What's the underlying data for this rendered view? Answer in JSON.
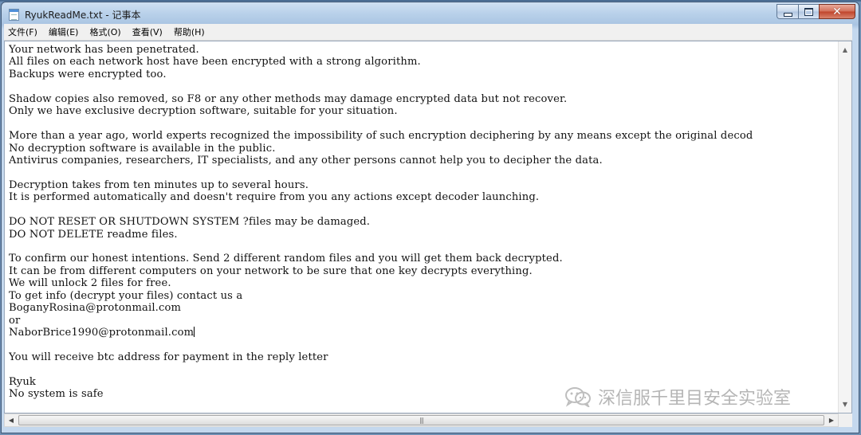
{
  "window": {
    "title": "RyukReadMe.txt - 记事本"
  },
  "menubar": {
    "items": [
      "文件(F)",
      "编辑(E)",
      "格式(O)",
      "查看(V)",
      "帮助(H)"
    ]
  },
  "document": {
    "lines": [
      "Your network has been penetrated.",
      "All files on each network host have been encrypted with a strong algorithm.",
      "Backups were encrypted too.",
      "",
      "Shadow copies also removed, so F8 or any other methods may damage encrypted data but not recover.",
      "Only we have exclusive decryption software, suitable for your situation.",
      "",
      "More than a year ago, world experts recognized the impossibility of such encryption deciphering by any means except the original decod",
      "No decryption software is available in the public.",
      "Antivirus companies, researchers, IT specialists, and any other persons cannot help you to decipher the data.",
      "",
      "Decryption takes from ten minutes up to several hours.",
      "It is performed automatically and doesn't require from you any actions except decoder launching.",
      "",
      "DO NOT RESET OR SHUTDOWN SYSTEM ?files may be damaged.",
      "DO NOT DELETE readme files.",
      "",
      "To confirm our honest intentions. Send 2 different random files and you will get them back decrypted.",
      "It can be from different computers on your network to be sure that one key decrypts everything.",
      "We will unlock 2 files for free.",
      "To get info (decrypt your files) contact us a",
      "BoganyRosina@protonmail.com",
      "or",
      "NaborBrice1990@protonmail.com",
      "",
      "You will receive btc address for payment in the reply letter",
      "",
      "Ryuk",
      "No system is safe"
    ]
  },
  "watermark": {
    "text": "深信服千里目安全实验室",
    "icon": "wechat-icon"
  },
  "icons": {
    "app": "notepad-icon",
    "minimize": "minimize-icon",
    "maximize": "maximize-icon",
    "close": "close-icon",
    "scroll_up": "scroll-up-arrow-icon",
    "scroll_down": "scroll-down-arrow-icon",
    "scroll_left": "scroll-left-arrow-icon",
    "scroll_right": "scroll-right-arrow-icon",
    "grip": "scrollbar-grip-icon"
  },
  "colors": {
    "titlebar": "#b9d1ea",
    "close_button": "#c0432a",
    "text": "#111111"
  }
}
